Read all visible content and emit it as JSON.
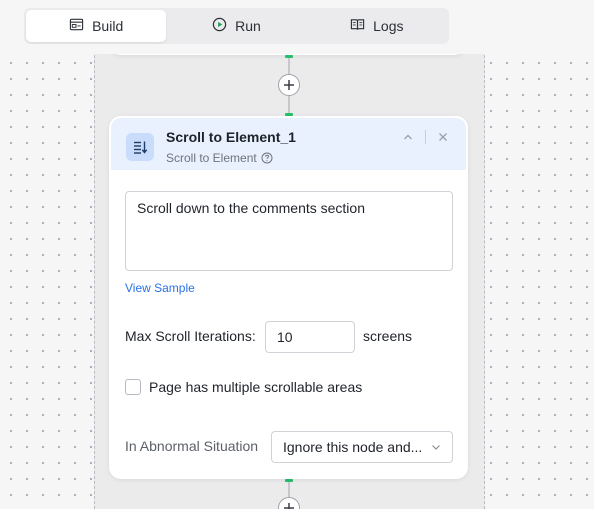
{
  "tabs": [
    {
      "label": "Build",
      "icon": "build-icon",
      "active": true
    },
    {
      "label": "Run",
      "icon": "play-icon",
      "active": false
    },
    {
      "label": "Logs",
      "icon": "book-icon",
      "active": false
    }
  ],
  "node": {
    "title": "Scroll to Element_1",
    "type_label": "Scroll to Element",
    "icon": "scroll-to-element-icon",
    "prompt": "Scroll down to the comments section",
    "view_sample_label": "View Sample",
    "max_scroll_label": "Max Scroll Iterations:",
    "max_scroll_value": "10",
    "max_scroll_unit": "screens",
    "multi_scroll_label": "Page has multiple scrollable areas",
    "multi_scroll_checked": false,
    "abnormal_label": "In Abnormal Situation",
    "abnormal_value": "Ignore this node and..."
  },
  "colors": {
    "accent": "#2a72e6",
    "connector_green": "#24c06b",
    "header_bg": "#e9f1fe"
  }
}
